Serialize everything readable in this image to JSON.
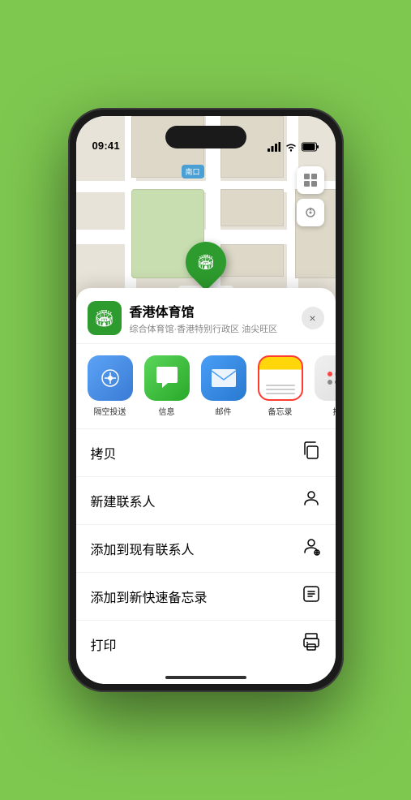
{
  "statusBar": {
    "time": "09:41",
    "signal": "●●●●",
    "wifi": "WiFi",
    "battery": "Batt"
  },
  "map": {
    "locationLabel": "南口",
    "pinLabel": "香港体育馆",
    "pinIcon": "🏟"
  },
  "sheet": {
    "venueName": "香港体育馆",
    "venueSub": "综合体育馆·香港特别行政区 油尖旺区",
    "venueIcon": "🏟",
    "closeLabel": "×"
  },
  "apps": [
    {
      "name": "airdrop",
      "label": "隔空投送",
      "icon": "📡",
      "selected": false
    },
    {
      "name": "messages",
      "label": "信息",
      "icon": "💬",
      "selected": false
    },
    {
      "name": "mail",
      "label": "邮件",
      "icon": "✉",
      "selected": false
    },
    {
      "name": "notes",
      "label": "备忘录",
      "icon": "📝",
      "selected": true
    },
    {
      "name": "more",
      "label": "推",
      "icon": "···",
      "selected": false
    }
  ],
  "actions": [
    {
      "id": "copy",
      "label": "拷贝",
      "icon": "⎘"
    },
    {
      "id": "new-contact",
      "label": "新建联系人",
      "icon": "👤"
    },
    {
      "id": "add-existing",
      "label": "添加到现有联系人",
      "icon": "👤"
    },
    {
      "id": "add-note",
      "label": "添加到新快速备忘录",
      "icon": "🔲"
    },
    {
      "id": "print",
      "label": "打印",
      "icon": "🖨"
    }
  ]
}
